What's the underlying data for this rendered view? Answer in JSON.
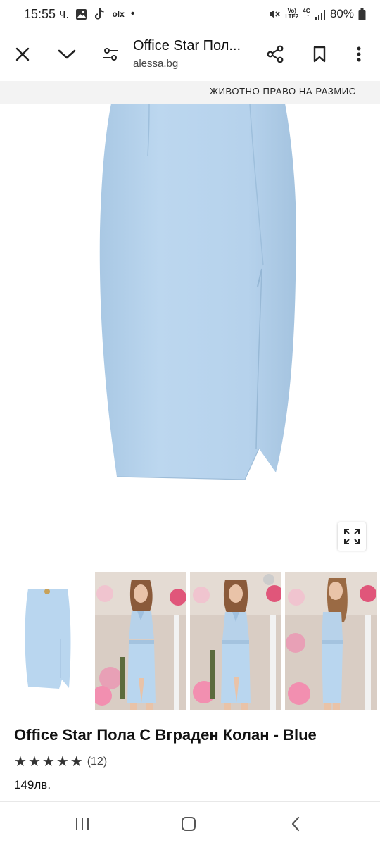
{
  "status_bar": {
    "time": "15:55 ч.",
    "notification_icons": [
      "gallery-icon",
      "tiktok-icon",
      "olx-icon",
      "dot-icon"
    ],
    "olx_label": "olx",
    "network_top": "Vo)",
    "network_bottom": "LTE2",
    "net_type": "4G",
    "battery": "80%"
  },
  "toolbar": {
    "page_title": "Office Star Пол...",
    "domain": "alessa.bg"
  },
  "banner": {
    "text": "ЖИВОТНО ПРАВО НА РАЗМИС"
  },
  "product": {
    "title": "Office Star Пола С Вграден Колан - Blue",
    "rating_stars": 5,
    "rating_count": "(12)",
    "price": "149лв.",
    "color": "#b9d6ef"
  },
  "thumbnails": [
    {
      "name": "skirt-only"
    },
    {
      "name": "model-front-1"
    },
    {
      "name": "model-front-2"
    },
    {
      "name": "model-side"
    }
  ]
}
